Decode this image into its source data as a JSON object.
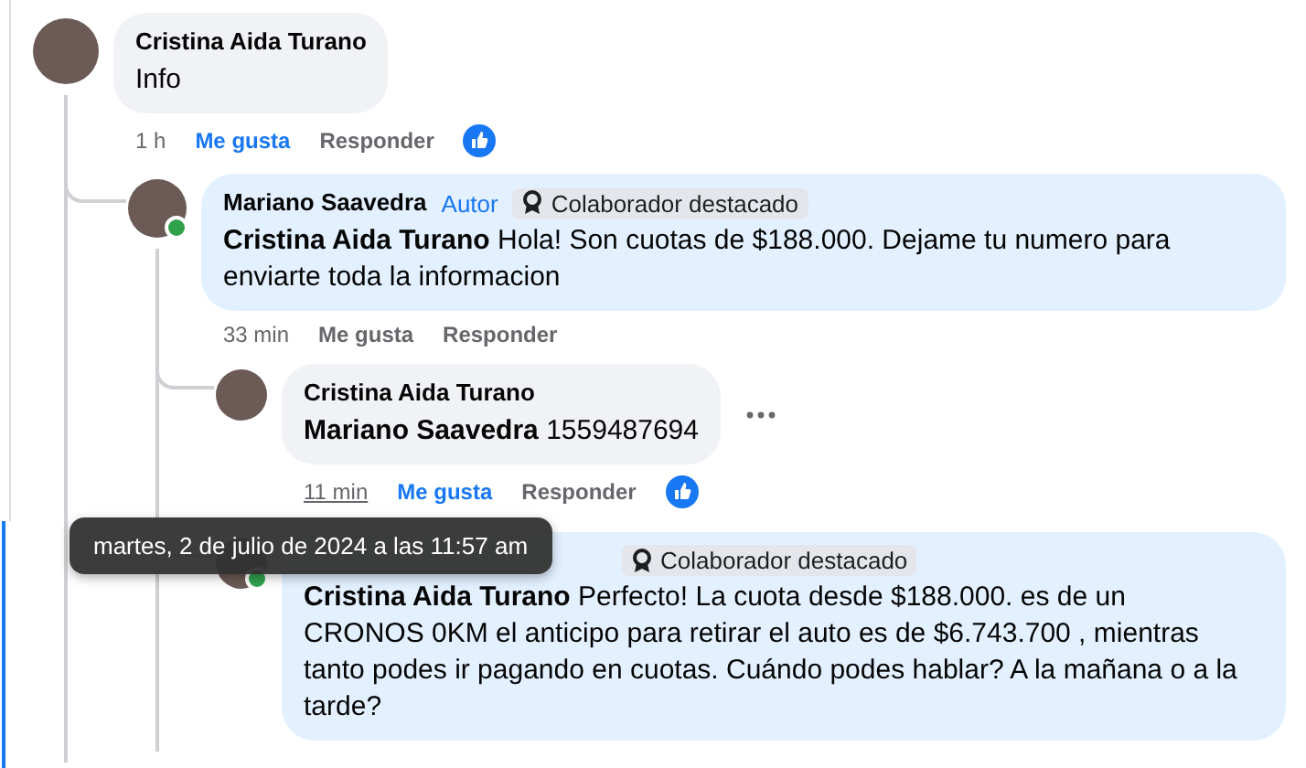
{
  "comments": [
    {
      "author": "Cristina Aida Turano",
      "online": false,
      "highlighted": false,
      "text": "Info",
      "time": "1 h",
      "time_hovered": false,
      "like_label": "Me gusta",
      "liked": true,
      "reply_label": "Responder",
      "reaction": true,
      "children": [
        {
          "author": "Mariano Saavedra",
          "author_tag": "Autor",
          "badge": "Colaborador destacado",
          "online": true,
          "highlighted": true,
          "text": "**Cristina Aida Turano** Hola! Son cuotas de $188.000. Dejame tu numero para enviarte toda la informacion",
          "time": "33 min",
          "time_hovered": false,
          "like_label": "Me gusta",
          "liked": false,
          "reply_label": "Responder",
          "children": [
            {
              "author": "Cristina Aida Turano",
              "online": false,
              "highlighted": false,
              "text": "**Mariano Saavedra** 1559487694",
              "time": "11 min",
              "time_hovered": true,
              "like_label": "Me gusta",
              "liked": true,
              "reply_label": "Responder",
              "reaction": true,
              "more_menu": true
            },
            {
              "badge": "Colaborador destacado",
              "online": true,
              "highlighted": true,
              "text": "**Cristina Aida Turano** Perfecto! La cuota desde $188.000. es de un CRONOS 0KM el anticipo para retirar el auto es de $6.743.700 , mientras tanto podes ir pagando en cuotas. Cuándo podes hablar? A la mañana o a la tarde?"
            }
          ]
        }
      ]
    }
  ],
  "tooltip": {
    "text": "martes, 2 de julio de 2024 a las 11:57 am"
  }
}
